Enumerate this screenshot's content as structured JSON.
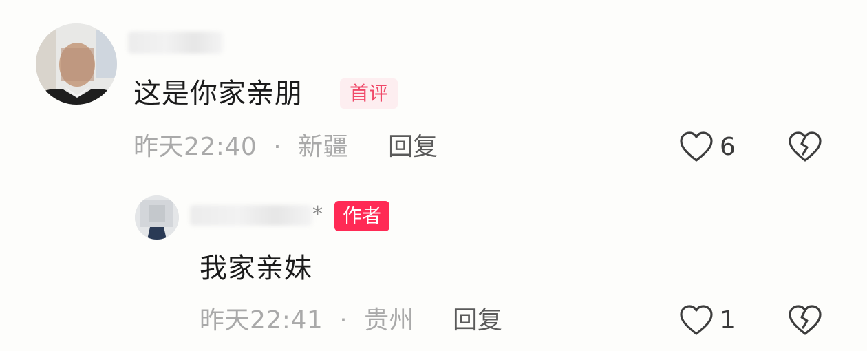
{
  "comments": [
    {
      "text": "这是你家亲朋",
      "tag": "首评",
      "time": "昨天22:40",
      "separator": "·",
      "location": "新疆",
      "reply_label": "回复",
      "like_count": "6",
      "icons": {
        "like": "heart-outline-icon",
        "dislike": "broken-heart-icon"
      }
    }
  ],
  "replies": [
    {
      "name_tail": "*",
      "tag": "作者",
      "text": "我家亲妹",
      "time": "昨天22:41",
      "separator": "·",
      "location": "贵州",
      "reply_label": "回复",
      "like_count": "1",
      "icons": {
        "like": "heart-outline-icon",
        "dislike": "broken-heart-icon"
      }
    }
  ],
  "colors": {
    "tag_first_bg": "#fdeef0",
    "tag_first_text": "#f04868",
    "tag_author_bg": "#ff2a55",
    "meta_text": "#a9a9a9"
  }
}
